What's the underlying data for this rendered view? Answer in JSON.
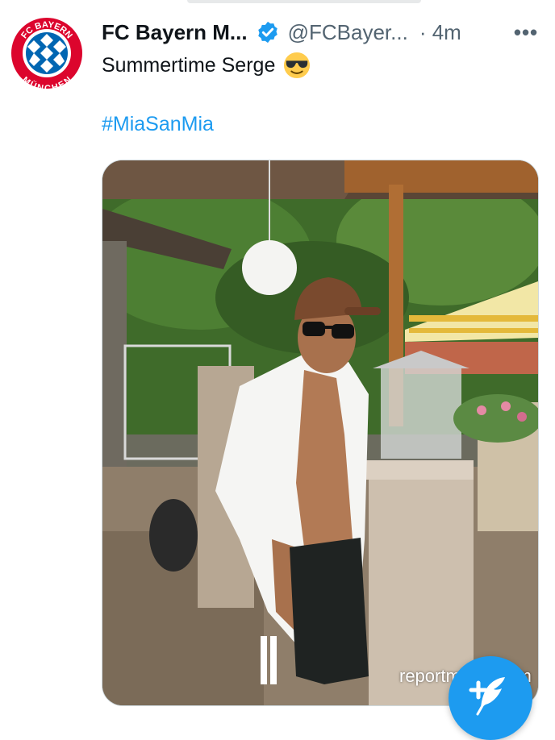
{
  "tweet": {
    "display_name": "FC Bayern M...",
    "handle": "@FCBayer...",
    "time": "· 4m",
    "more_label": "•••",
    "text": "Summertime Serge",
    "emoji": "smiling-face-with-sunglasses",
    "hashtag": "#MiaSanMia"
  },
  "avatar": {
    "logo_top_text": "FC BAYERN",
    "logo_bottom_text": "MÜNCHEN",
    "colors": {
      "red": "#dc052d",
      "blue": "#0066b2",
      "white": "#ffffff"
    }
  },
  "media": {
    "description_icon": "photo",
    "watermark": "reportminds.com"
  },
  "fab": {
    "icon": "compose-tweet-icon",
    "color": "#1d9bf0"
  },
  "colors": {
    "link": "#1d9bf0",
    "verified": "#1d9bf0",
    "secondary_text": "#536471",
    "primary_text": "#0f1419"
  }
}
